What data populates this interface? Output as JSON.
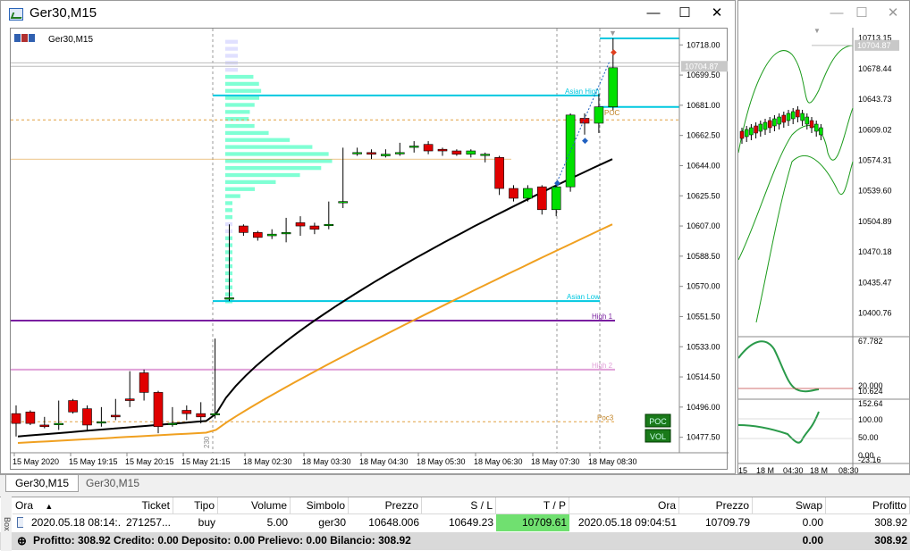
{
  "main_window": {
    "title": "Ger30,M15",
    "chart_label": "Ger30,M15",
    "buttons": {
      "minimize": "—",
      "maximize": "☐",
      "close": "✕"
    }
  },
  "second_window": {
    "buttons": {
      "minimize": "—",
      "maximize": "☐",
      "close": "✕"
    }
  },
  "chart_data": {
    "type": "candlestick",
    "symbol": "Ger30,M15",
    "price_axis_labels": [
      "10718.00",
      "10699.50",
      "10681.00",
      "10662.50",
      "10644.00",
      "10625.50",
      "10607.00",
      "10588.50",
      "10570.00",
      "10551.50",
      "10533.00",
      "10514.50",
      "10496.00",
      "10477.50"
    ],
    "current_price_label": "10704.87",
    "time_axis_labels": [
      "15 May 2020",
      "15 May 19:15",
      "15 May 20:15",
      "15 May 21:15",
      "18 May 02:30",
      "18 May 03:30",
      "18 May 04:30",
      "18 May 05:30",
      "18 May 06:30",
      "18 May 07:30",
      "18 May 08:30"
    ],
    "level_labels": {
      "asian_high": "Asian High",
      "asian_low": "Asian Low",
      "high1": "High 1",
      "high2": "High 2",
      "poc3": "Poc3",
      "poc": "POC",
      "session": "230"
    },
    "buttons": {
      "poc": "POC",
      "vol": "VOL"
    },
    "candles": [
      [
        10492,
        10497,
        10486,
        10478
      ],
      [
        10493,
        10494,
        10486,
        10485
      ],
      [
        10485,
        10490,
        10484,
        10483
      ],
      [
        10486,
        10500,
        10486,
        10482
      ],
      [
        10500,
        10501,
        10493,
        10492
      ],
      [
        10495,
        10497,
        10485,
        10482
      ],
      [
        10487,
        10496,
        10487,
        10484
      ],
      [
        10491,
        10501,
        10490,
        10488
      ],
      [
        10501,
        10518,
        10500,
        10496
      ],
      [
        10517,
        10519,
        10505,
        10500
      ],
      [
        10505,
        10506,
        10484,
        10480
      ],
      [
        10486,
        10496,
        10486,
        10484
      ],
      [
        10494,
        10497,
        10492,
        10488
      ],
      [
        10492,
        10499,
        10490,
        10486
      ],
      [
        10492,
        10538,
        10492,
        10489
      ],
      [
        10563,
        10608,
        10563,
        10561
      ],
      [
        10607,
        10608,
        10603,
        10601
      ],
      [
        10603,
        10604,
        10600,
        10598
      ],
      [
        10601,
        10605,
        10602,
        10599
      ],
      [
        10603,
        10612,
        10603,
        10597
      ],
      [
        10609,
        10613,
        10607,
        10601
      ],
      [
        10607,
        10609,
        10605,
        10602
      ],
      [
        10608,
        10622,
        10608,
        10605
      ],
      [
        10622,
        10655,
        10622,
        10618
      ],
      [
        10652,
        10655,
        10652,
        10650
      ],
      [
        10652,
        10654,
        10651,
        10648
      ],
      [
        10650,
        10654,
        10651,
        10649
      ],
      [
        10652,
        10658,
        10652,
        10650
      ],
      [
        10656,
        10659,
        10656,
        10652
      ],
      [
        10657,
        10659,
        10653,
        10651
      ],
      [
        10654,
        10655,
        10653,
        10650
      ],
      [
        10653,
        10654,
        10651,
        10650
      ],
      [
        10651,
        10654,
        10653,
        10649
      ],
      [
        10651,
        10652,
        10651,
        10646
      ],
      [
        10649,
        10650,
        10630,
        10626
      ],
      [
        10630,
        10632,
        10624,
        10622
      ],
      [
        10624,
        10632,
        10630,
        10622
      ],
      [
        10631,
        10632,
        10617,
        10614
      ],
      [
        10617,
        10632,
        10631,
        10613
      ],
      [
        10631,
        10676,
        10675,
        10628
      ],
      [
        10673,
        10676,
        10670,
        10663
      ],
      [
        10670,
        10688,
        10680,
        10664
      ],
      [
        10680,
        10722,
        10704,
        10678
      ]
    ],
    "secondary_price_labels": [
      "10713.15",
      "10678.44",
      "10643.73",
      "10609.02",
      "10574.31",
      "10539.60",
      "10504.89",
      "10470.18",
      "10435.47",
      "10400.76"
    ],
    "secondary_current_label": "10704.87",
    "indicator1_labels": [
      "67.782",
      "20.000",
      "10.624"
    ],
    "indicator2_labels": [
      "152.64",
      "100.00",
      "50.00",
      "0.00",
      "-23.16"
    ],
    "secondary_time_labels": [
      "15",
      "18 M",
      "04:30",
      "18 M",
      "08:30"
    ]
  },
  "tabs": [
    {
      "label": "Ger30,M15"
    },
    {
      "label": "Ger30,M15"
    }
  ],
  "trade_table": {
    "columns": [
      "Ora",
      "Ticket",
      "Tipo",
      "Volume",
      "Simbolo",
      "Prezzo",
      "S / L",
      "T / P",
      "Ora",
      "Prezzo",
      "Swap",
      "Profitto"
    ],
    "sort_indicator": "▲",
    "row": [
      "2020.05.18 08:14:...",
      "271257...",
      "buy",
      "5.00",
      "ger30",
      "10648.006",
      "10649.23",
      "10709.61",
      "2020.05.18 09:04:51",
      "10709.79",
      "0.00",
      "308.92"
    ],
    "summary": "Profitto: 308.92  Credito: 0.00  Deposito: 0.00  Prelievo: 0.00  Bilancio: 308.92",
    "summary_swap": "0.00",
    "summary_profit": "308.92",
    "side_tab": "Box"
  },
  "colors": {
    "bull": "#00e000",
    "bear": "#e00000",
    "asian": "#00c8e0",
    "high1": "#7a1fa0",
    "high2": "#e0a0d8",
    "ema_fast": "#000000",
    "ema_slow": "#f0a020",
    "profile": "#7fffd4",
    "tp_cell": "#70e070"
  }
}
